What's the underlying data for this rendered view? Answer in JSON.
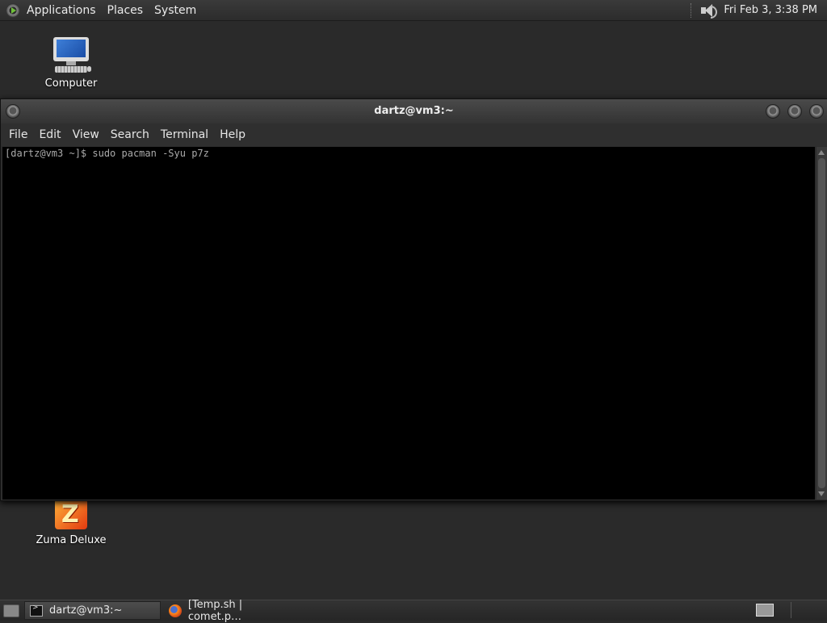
{
  "top_panel": {
    "menus": [
      "Applications",
      "Places",
      "System"
    ],
    "clock": "Fri Feb  3,  3:38 PM",
    "icons": {
      "logo": "distro-logo-icon",
      "volume": "speaker-icon"
    }
  },
  "desktop": {
    "icons": [
      {
        "label": "Computer",
        "icon": "computer-icon"
      },
      {
        "label": "Zuma Deluxe",
        "icon": "zuma-icon"
      }
    ]
  },
  "window": {
    "title": "dartz@vm3:~",
    "menu": [
      "File",
      "Edit",
      "View",
      "Search",
      "Terminal",
      "Help"
    ],
    "terminal_text": "[dartz@vm3 ~]$ sudo pacman -Syu p7z"
  },
  "taskbar": {
    "tasks": [
      {
        "label": "dartz@vm3:~",
        "icon": "terminal-icon",
        "active": true
      },
      {
        "label": "[Temp.sh | comet.p…",
        "icon": "firefox-icon",
        "active": false
      }
    ]
  },
  "colors": {
    "terminal_bg": "#000000",
    "terminal_fg": "#aaaaaa",
    "panel_bg": "#2c2c2c"
  }
}
